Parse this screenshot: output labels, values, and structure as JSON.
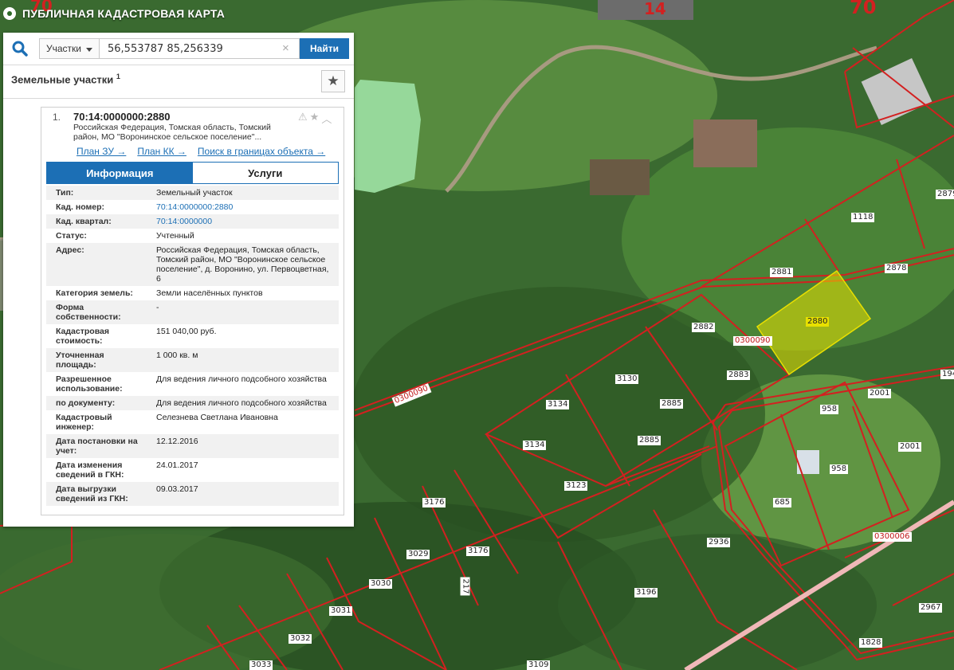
{
  "app": {
    "title": "ПУБЛИЧНАЯ КАДАСТРОВАЯ КАРТА"
  },
  "search": {
    "type_label": "Участки",
    "value": "56,553787 85,256339",
    "button_label": "Найти"
  },
  "results": {
    "section_title": "Земельные участки",
    "count": "1",
    "item": {
      "index": "1.",
      "number": "70:14:0000000:2880",
      "address_short": "Российская Федерация, Томская область, Томский район, МО \"Воронинское сельское поселение\"...",
      "links": [
        "План ЗУ →",
        "План КК →",
        "Поиск в границах объекта →"
      ],
      "tabs": [
        "Информация",
        "Услуги"
      ],
      "rows": [
        {
          "k": "Тип:",
          "v": "Земельный участок"
        },
        {
          "k": "Кад. номер:",
          "v": "70:14:0000000:2880"
        },
        {
          "k": "Кад. квартал:",
          "v": "70:14:0000000"
        },
        {
          "k": "Статус:",
          "v": "Учтенный"
        },
        {
          "k": "Адрес:",
          "v": "Российская Федерация, Томская область, Томский район, МО \"Воронинское сельское поселение\", д. Воронино, ул. Первоцветная, 6"
        },
        {
          "k": "Категория земель:",
          "v": "Земли населённых пунктов"
        },
        {
          "k": "Форма собственности:",
          "v": "-"
        },
        {
          "k": "Кадастровая стоимость:",
          "v": "151 040,00 руб."
        },
        {
          "k": "Уточненная площадь:",
          "v": "1 000 кв. м"
        },
        {
          "k": "Разрешенное использование:",
          "v": "Для ведения личного подсобного хозяйства"
        },
        {
          "k": "по документу:",
          "v": "Для ведения личного подсобного хозяйства"
        },
        {
          "k": "Кадастровый инженер:",
          "v": "Селезнева Светлана Ивановна"
        },
        {
          "k": "Дата постановки на учет:",
          "v": "12.12.2016"
        },
        {
          "k": "Дата изменения сведений в ГКН:",
          "v": "24.01.2017"
        },
        {
          "k": "Дата выгрузки сведений из ГКН:",
          "v": "09.03.2017"
        }
      ]
    }
  },
  "map_labels": {
    "big": [
      "70",
      "14",
      "70"
    ],
    "quarter": [
      "0300090",
      "0300090",
      "0300006"
    ],
    "parcels": [
      "2879",
      "1118",
      "2881",
      "2878",
      "2880",
      "2882",
      "2883",
      "3130",
      "2885",
      "3134",
      "3134",
      "2885",
      "2001",
      "958",
      "2001",
      "958",
      "3123",
      "685",
      "194",
      "3176",
      "3176",
      "3029",
      "3030",
      "217",
      "2936",
      "3196",
      "3031",
      "3032",
      "2967",
      "1828",
      "3033",
      "3109"
    ]
  },
  "colors": {
    "accent": "#1c6fb5",
    "boundary": "#d32020",
    "highlight": "#e8e000"
  }
}
